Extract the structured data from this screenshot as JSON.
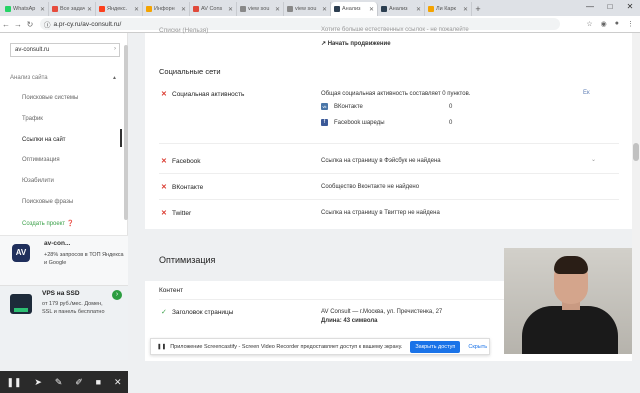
{
  "browser": {
    "tabs": [
      {
        "label": "WhatsAp",
        "active": false
      },
      {
        "label": "Все задач",
        "active": false
      },
      {
        "label": "Яндекс.",
        "active": false
      },
      {
        "label": "Инфорн",
        "active": false
      },
      {
        "label": "AV Cons",
        "active": false
      },
      {
        "label": "view sou",
        "active": false
      },
      {
        "label": "view sou",
        "active": false
      },
      {
        "label": "Анализ",
        "active": true
      },
      {
        "label": "Анализ",
        "active": false
      },
      {
        "label": "Ли Карк",
        "active": false
      }
    ],
    "new_tab": "+",
    "window_controls": {
      "minimize": "—",
      "maximize": "□",
      "close": "✕"
    },
    "url": "a.pr-cy.ru/av-consult.ru/",
    "lock": "ⓘ"
  },
  "sidebar": {
    "site_select": "av-consult.ru",
    "menu_header": "Анализ сайта",
    "items": [
      {
        "label": "Поисковые системы"
      },
      {
        "label": "Трафик"
      },
      {
        "label": "Ссылки на сайт"
      },
      {
        "label": "Оптимизация"
      },
      {
        "label": "Юзабилити"
      },
      {
        "label": "Поисковые фразы"
      }
    ],
    "create_project": "Создать проект",
    "ad1": {
      "title": "av-con...",
      "text": "+28% запросов в ТОП Яндекса и Google"
    },
    "ad2": {
      "title": "VPS на SSD",
      "text": "от 179 руб./мес. Домен, SSL и панель бесплатно"
    }
  },
  "main": {
    "top_snippet": "Списки (Нельзя)",
    "top_snippet_note": "Хотите больше естественных ссылок - не пожалейте",
    "promo_link": "Начать продвижение",
    "social_title": "Социальные сети",
    "social_activity": {
      "label": "Социальная активность",
      "summary": "Общая социальная активность составляет 0 пунктов.",
      "vk_label": "ВКонтакте",
      "vk_value": "0",
      "fb_label": "Facebook шареды",
      "fb_value": "0",
      "badge": "Ек"
    },
    "rows": [
      {
        "label": "Facebook",
        "text": "Ссылка на страницу в Фэйсбук не найдена"
      },
      {
        "label": "ВКонтакте",
        "text": "Сообщество Вконтакте не найдено"
      },
      {
        "label": "Twitter",
        "text": "Ссылка на страницу в Твиттер не найдена"
      }
    ],
    "optimization_title": "Оптимизация",
    "content_title": "Контент",
    "title_row": {
      "label": "Заголовок страницы",
      "text": "AV Consult — г.Москва, ул. Пречистенка, 27",
      "length": "Длина: 43 символа"
    }
  },
  "notification": {
    "text": "Приложение Screencastify - Screen Video Recorder предоставляет доступ к вашему экрану.",
    "share": "Закрыть доступ",
    "hide": "Скрыть"
  }
}
